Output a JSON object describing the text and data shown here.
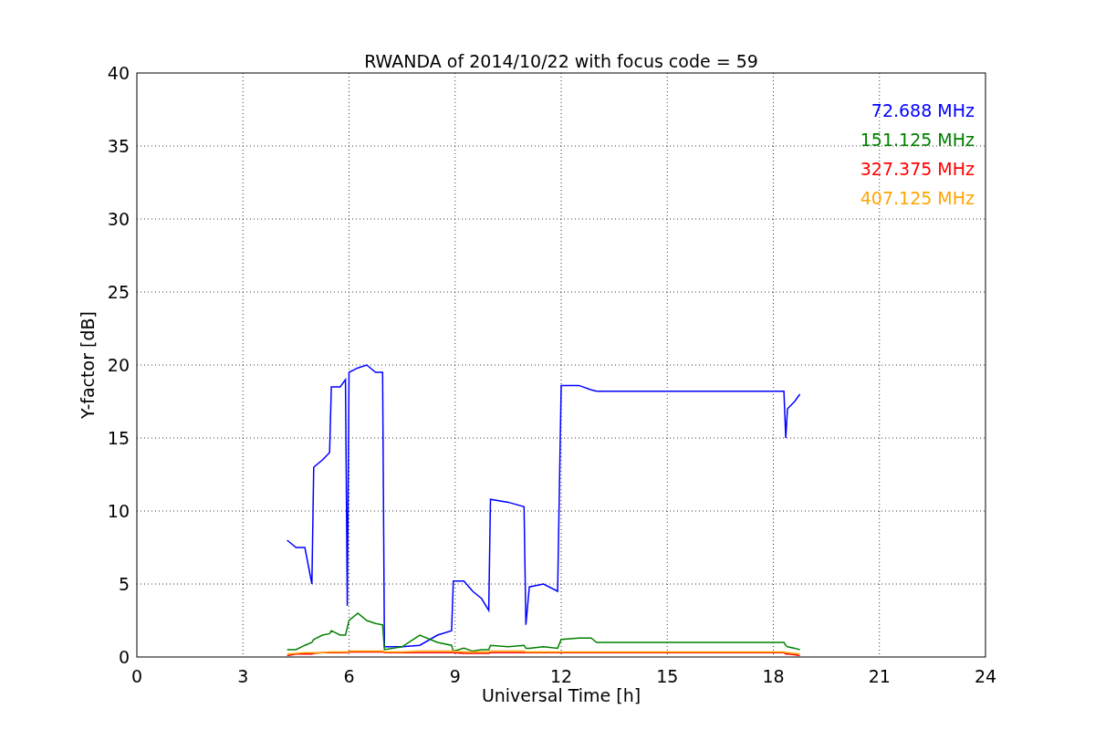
{
  "figure": {
    "chart_data": {
      "type": "line",
      "title": "RWANDA of 2014/10/22 with focus code = 59",
      "xlabel": "Universal Time [h]",
      "ylabel": "Y-factor [dB]",
      "x": [
        4.25,
        4.5,
        4.75,
        4.95,
        5.0,
        5.25,
        5.45,
        5.5,
        5.75,
        5.9,
        5.95,
        6.0,
        6.25,
        6.5,
        6.75,
        6.95,
        7.0,
        7.5,
        8.0,
        8.5,
        8.9,
        8.95,
        9.25,
        9.5,
        9.75,
        9.95,
        10.0,
        10.5,
        10.95,
        11.0,
        11.1,
        11.5,
        11.9,
        12.0,
        12.5,
        12.85,
        13.0,
        18.3,
        18.35,
        18.4,
        18.6,
        18.75
      ],
      "series": [
        {
          "name": "72.688 MHz",
          "color": "#0000ff",
          "values": [
            8,
            7.5,
            7.5,
            5,
            13,
            13.5,
            14,
            18.5,
            18.5,
            19,
            3.5,
            19.5,
            19.8,
            20,
            19.5,
            19.5,
            0.7,
            0.7,
            0.8,
            1.5,
            1.8,
            5.2,
            5.2,
            4.5,
            4,
            3.2,
            10.8,
            10.6,
            10.3,
            2.2,
            4.8,
            5,
            4.5,
            18.6,
            18.6,
            18.3,
            18.2,
            18.2,
            15,
            17,
            17.5,
            18
          ]
        },
        {
          "name": "151.125 MHz",
          "color": "#008000",
          "values": [
            0.5,
            0.5,
            0.8,
            1.0,
            1.2,
            1.5,
            1.6,
            1.8,
            1.5,
            1.5,
            2,
            2.5,
            3,
            2.5,
            2.3,
            2.2,
            0.5,
            0.7,
            1.5,
            1,
            0.8,
            0.4,
            0.6,
            0.4,
            0.5,
            0.5,
            0.8,
            0.7,
            0.8,
            0.6,
            0.6,
            0.7,
            0.6,
            1.2,
            1.3,
            1.3,
            1.0,
            1.0,
            0.8,
            0.7,
            0.6,
            0.5
          ]
        },
        {
          "name": "327.375 MHz",
          "color": "#ff0000",
          "values": [
            0.1,
            0.2,
            0.2,
            0.2,
            0.25,
            0.3,
            0.3,
            0.3,
            0.3,
            0.3,
            0.3,
            0.35,
            0.35,
            0.35,
            0.35,
            0.35,
            0.3,
            0.3,
            0.3,
            0.3,
            0.3,
            0.3,
            0.25,
            0.25,
            0.25,
            0.25,
            0.3,
            0.3,
            0.3,
            0.3,
            0.3,
            0.3,
            0.3,
            0.3,
            0.3,
            0.3,
            0.3,
            0.3,
            0.2,
            0.2,
            0.15,
            0.1
          ]
        },
        {
          "name": "407.125 MHz",
          "color": "#ffa500",
          "values": [
            0.2,
            0.25,
            0.3,
            0.3,
            0.3,
            0.3,
            0.35,
            0.35,
            0.35,
            0.35,
            0.35,
            0.4,
            0.4,
            0.4,
            0.4,
            0.4,
            0.35,
            0.35,
            0.4,
            0.4,
            0.4,
            0.4,
            0.35,
            0.35,
            0.35,
            0.35,
            0.4,
            0.4,
            0.4,
            0.35,
            0.35,
            0.35,
            0.35,
            0.35,
            0.35,
            0.35,
            0.35,
            0.35,
            0.3,
            0.3,
            0.25,
            0.2
          ]
        }
      ],
      "grid": true,
      "xlim": [
        0,
        24
      ],
      "ylim": [
        0,
        40
      ],
      "xticks": [
        0,
        3,
        6,
        9,
        12,
        15,
        18,
        21,
        24
      ],
      "yticks": [
        0,
        5,
        10,
        15,
        20,
        25,
        30,
        35,
        40
      ]
    }
  }
}
